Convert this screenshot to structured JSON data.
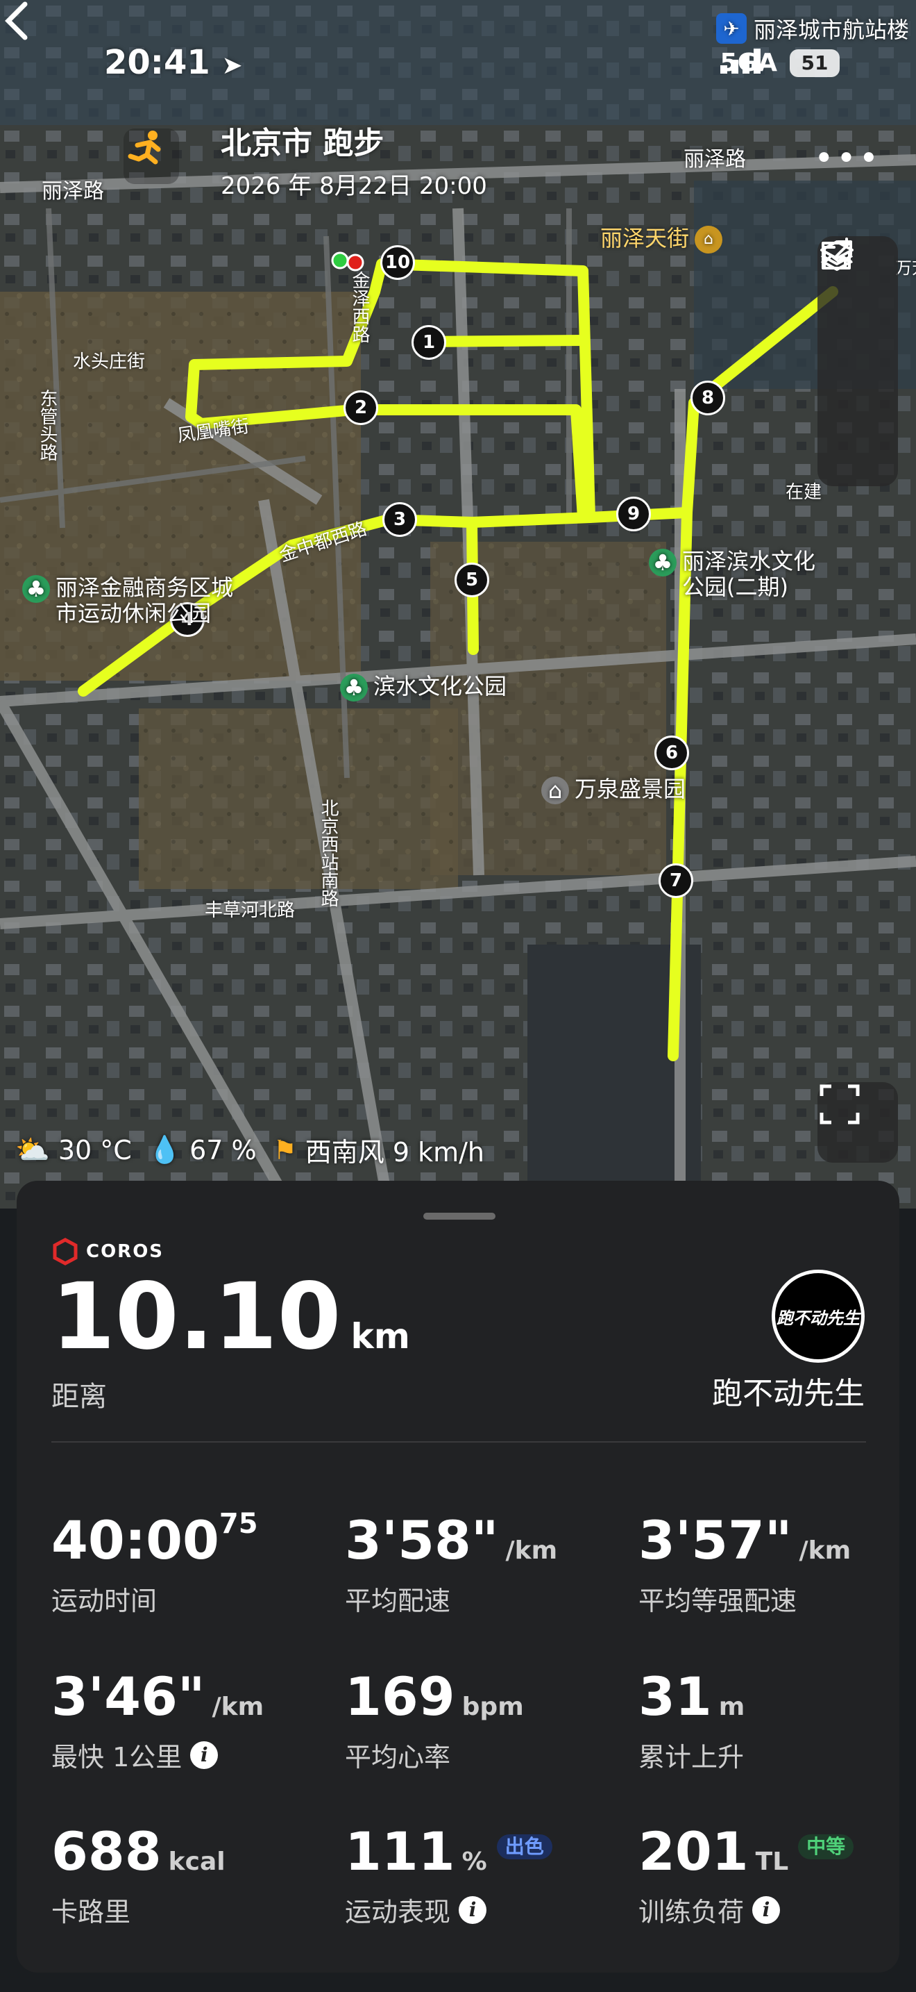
{
  "status_bar": {
    "time": "20:41",
    "network": "5GA",
    "battery": "51"
  },
  "header": {
    "title": "北京市 跑步",
    "datetime": "2026 年 8月22日 20:00"
  },
  "map": {
    "airport_label": "丽泽城市航站楼",
    "road_labels": [
      "丽泽路",
      "丽泽路",
      "水头庄街",
      "东管头路",
      "凤凰嘴街",
      "金泽西路",
      "金中都西路",
      "北京西站南路",
      "丰草河北路",
      "万芳"
    ],
    "poi": {
      "lize_tianjie": "丽泽天街",
      "lize_finance_park": "丽泽金融商务区城市运动休闲公园",
      "lize_binshui_park": "丽泽滨水文化公园(二期)",
      "binshui_park": "滨水文化公园",
      "wanquan": "万泉盛景园",
      "zaijian": "在建"
    },
    "km_markers": [
      "1",
      "2",
      "3",
      "4",
      "5",
      "6",
      "7",
      "8",
      "9",
      "10"
    ],
    "route_color": "#e6ff1f"
  },
  "weather": {
    "temperature": "30 °C",
    "humidity": "67 %",
    "wind": "西南风 9 km/h"
  },
  "panel": {
    "brand": "COROS",
    "distance_value": "10.10",
    "distance_unit": "km",
    "distance_label": "距离",
    "avatar_text": "跑不动先生",
    "nickname": "跑不动先生",
    "stats": [
      {
        "value": "40:00",
        "sup": "75",
        "unit": "",
        "label": "运动时间"
      },
      {
        "value": "3'58\"",
        "unit": "/km",
        "label": "平均配速"
      },
      {
        "value": "3'57\"",
        "unit": "/km",
        "label": "平均等强配速"
      },
      {
        "value": "3'46\"",
        "unit": "/km",
        "label": "最快 1公里"
      },
      {
        "value": "169",
        "unit": "bpm",
        "label": "平均心率"
      },
      {
        "value": "31",
        "unit": "m",
        "label": "累计上升"
      },
      {
        "value": "688",
        "unit": "kcal",
        "label": "卡路里"
      },
      {
        "value": "111",
        "unit": "%",
        "badge": "出色",
        "label": "运动表现"
      },
      {
        "value": "201",
        "unit": "TL",
        "badge": "中等",
        "label": "训练负荷"
      }
    ]
  }
}
